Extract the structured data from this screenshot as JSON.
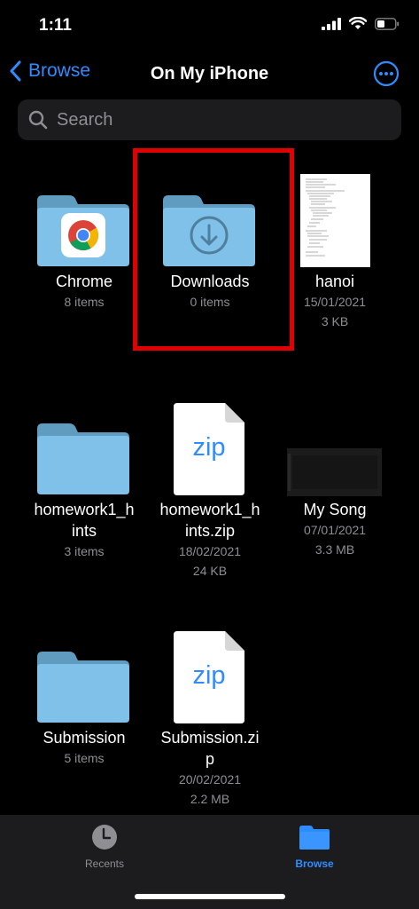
{
  "status": {
    "time": "1:11"
  },
  "nav": {
    "back_label": "Browse",
    "title": "On My iPhone"
  },
  "search": {
    "placeholder": "Search"
  },
  "items": [
    {
      "name": "Chrome",
      "meta1": "8 items",
      "meta2": "",
      "kind": "folder-chrome"
    },
    {
      "name": "Downloads",
      "meta1": "0 items",
      "meta2": "",
      "kind": "folder-downloads"
    },
    {
      "name": "hanoi",
      "meta1": "15/01/2021",
      "meta2": "3 KB",
      "kind": "document"
    },
    {
      "name": "homework1_h\nints",
      "meta1": "3 items",
      "meta2": "",
      "kind": "folder"
    },
    {
      "name": "homework1_h\nints.zip",
      "meta1": "18/02/2021",
      "meta2": "24 KB",
      "kind": "zip",
      "badge": "zip"
    },
    {
      "name": "My Song",
      "meta1": "07/01/2021",
      "meta2": "3.3 MB",
      "kind": "video"
    },
    {
      "name": "Submission",
      "meta1": "5 items",
      "meta2": "",
      "kind": "folder"
    },
    {
      "name": "Submission.zi\np",
      "meta1": "20/02/2021",
      "meta2": "2.2 MB",
      "kind": "zip",
      "badge": "zip"
    }
  ],
  "tabs": [
    {
      "label": "Recents",
      "icon": "clock-icon",
      "active": false
    },
    {
      "label": "Browse",
      "icon": "folder-icon",
      "active": true
    }
  ],
  "colors": {
    "accent": "#2f8cff",
    "highlight": "#e00000",
    "folder": "#7fc1e8"
  }
}
